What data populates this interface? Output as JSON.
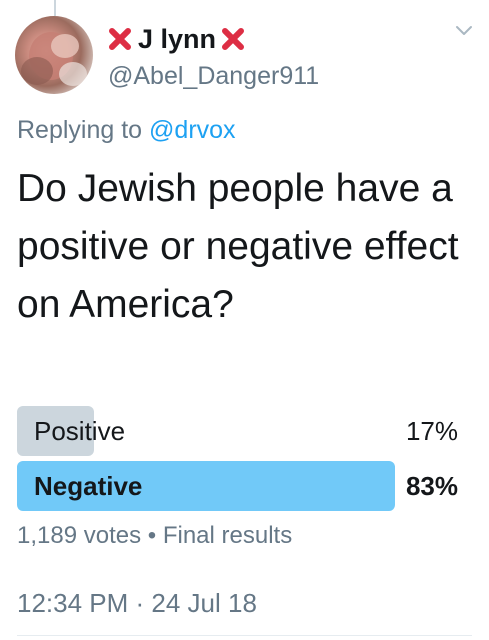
{
  "tweet": {
    "author": {
      "display_name": "J lynn",
      "handle": "@Abel_Danger911",
      "name_emoji_icon": "cross-mark-icon"
    },
    "reply": {
      "prefix": "Replying to",
      "mention": "@drvox"
    },
    "text": "Do Jewish people have a positive or negative effect on America?",
    "poll": {
      "options": [
        {
          "label": "Positive",
          "percent_text": "17%",
          "percent": 17,
          "winner": false
        },
        {
          "label": "Negative",
          "percent_text": "83%",
          "percent": 83,
          "winner": true
        }
      ],
      "votes": "1,189 votes",
      "separator": "•",
      "status": "Final results"
    },
    "timestamp": "12:34 PM · 24 Jul 18"
  },
  "colors": {
    "accent": "#1da1f2",
    "winner_bar": "#71c9f8",
    "loser_bar": "#ccd6dd",
    "secondary_text": "#657786",
    "cross_mark": "#dd2e44"
  },
  "icons": {
    "menu": "chevron-down-icon"
  }
}
